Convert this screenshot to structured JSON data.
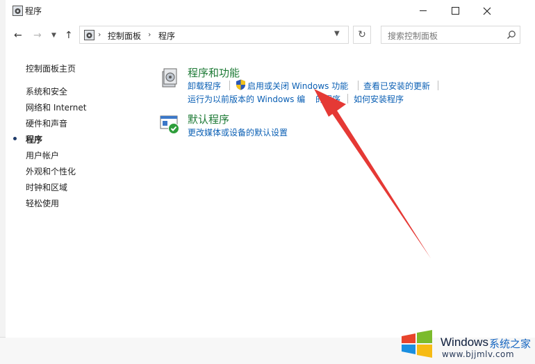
{
  "window": {
    "title": "程序"
  },
  "nav": {
    "breadcrumb": [
      "控制面板",
      "程序"
    ],
    "search_placeholder": "搜索控制面板"
  },
  "sidebar": {
    "items": [
      "控制面板主页",
      "系统和安全",
      "网络和 Internet",
      "硬件和声音",
      "程序",
      "用户帐户",
      "外观和个性化",
      "时钟和区域",
      "轻松使用"
    ],
    "selected": "程序"
  },
  "categories": {
    "programs_features": {
      "title": "程序和功能",
      "links": [
        "卸载程序",
        "启用或关闭 Windows 功能",
        "查看已安装的更新",
        "运行为以前版本的 Windows 编",
        "的程序",
        "如何安装程序"
      ]
    },
    "default_programs": {
      "title": "默认程序",
      "links": [
        "更改媒体或设备的默认设置"
      ]
    }
  },
  "watermark": {
    "brand": "Windows",
    "brand_cn": "系统之家",
    "url": "www.bjjmlv.com"
  },
  "colors": {
    "link": "#0a5fb4",
    "category_title": "#1e7a36",
    "annotation_arrow": "#e53935"
  }
}
